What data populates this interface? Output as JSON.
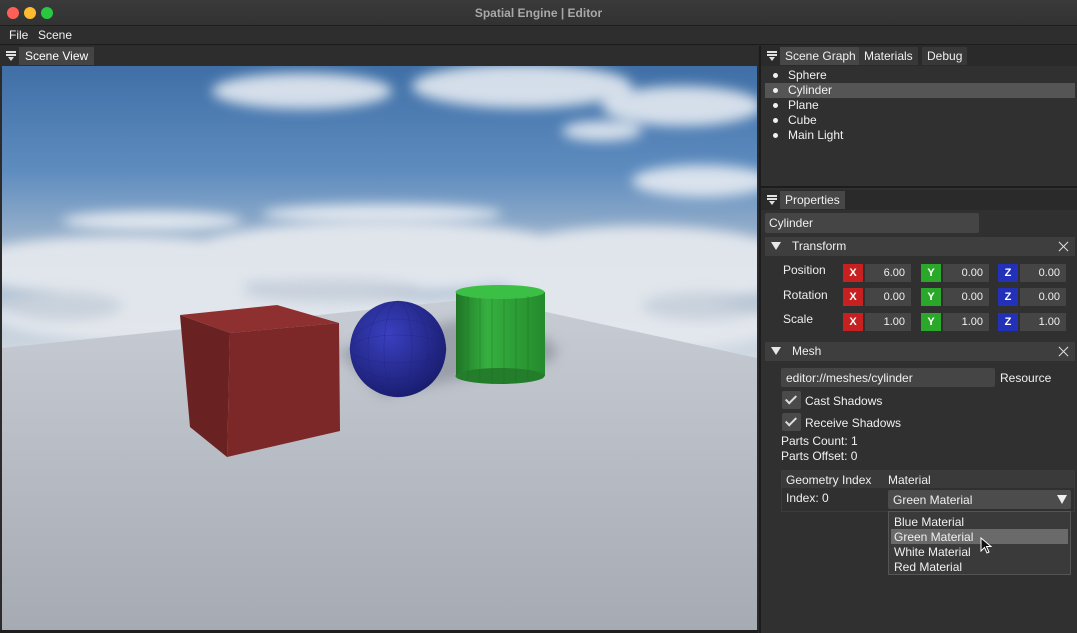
{
  "window": {
    "title": "Spatial Engine | Editor"
  },
  "menu": [
    {
      "label": "File"
    },
    {
      "label": "Scene"
    }
  ],
  "scene_view": {
    "tab_label": "Scene View"
  },
  "scene_graph": {
    "tabs": [
      {
        "label": "Scene Graph"
      },
      {
        "label": "Materials"
      },
      {
        "label": "Debug"
      }
    ],
    "items": [
      {
        "label": "Sphere"
      },
      {
        "label": "Cylinder",
        "selected": true
      },
      {
        "label": "Plane"
      },
      {
        "label": "Cube"
      },
      {
        "label": "Main Light"
      }
    ]
  },
  "properties": {
    "tab_label": "Properties",
    "object_name": "Cylinder",
    "transform": {
      "title": "Transform",
      "axis_labels": [
        "X",
        "Y",
        "Z"
      ],
      "rows": [
        {
          "label": "Position",
          "x": "6.00",
          "y": "0.00",
          "z": "0.00"
        },
        {
          "label": "Rotation",
          "x": "0.00",
          "y": "0.00",
          "z": "0.00"
        },
        {
          "label": "Scale",
          "x": "1.00",
          "y": "1.00",
          "z": "1.00"
        }
      ]
    },
    "mesh": {
      "title": "Mesh",
      "resource_value": "editor://meshes/cylinder",
      "resource_label": "Resource",
      "cast_shadows": {
        "label": "Cast Shadows",
        "checked": true
      },
      "receive_shadows": {
        "label": "Receive Shadows",
        "checked": true
      },
      "parts_count": "Parts Count: 1",
      "parts_offset": "Parts Offset: 0",
      "table": {
        "headers": [
          "Geometry Index",
          "Material"
        ],
        "index_label": "Index: 0",
        "selected_material": "Green Material",
        "options": [
          "Blue Material",
          "Green Material",
          "White Material",
          "Red Material"
        ],
        "highlighted_option": "Green Material"
      }
    }
  },
  "colors": {
    "axis_x": "#c62020",
    "axis_y": "#2aa82a",
    "axis_z": "#2330b8",
    "cube": "#7a2828",
    "sphere": "#2a2f9a",
    "cylinder": "#2f9a36"
  }
}
